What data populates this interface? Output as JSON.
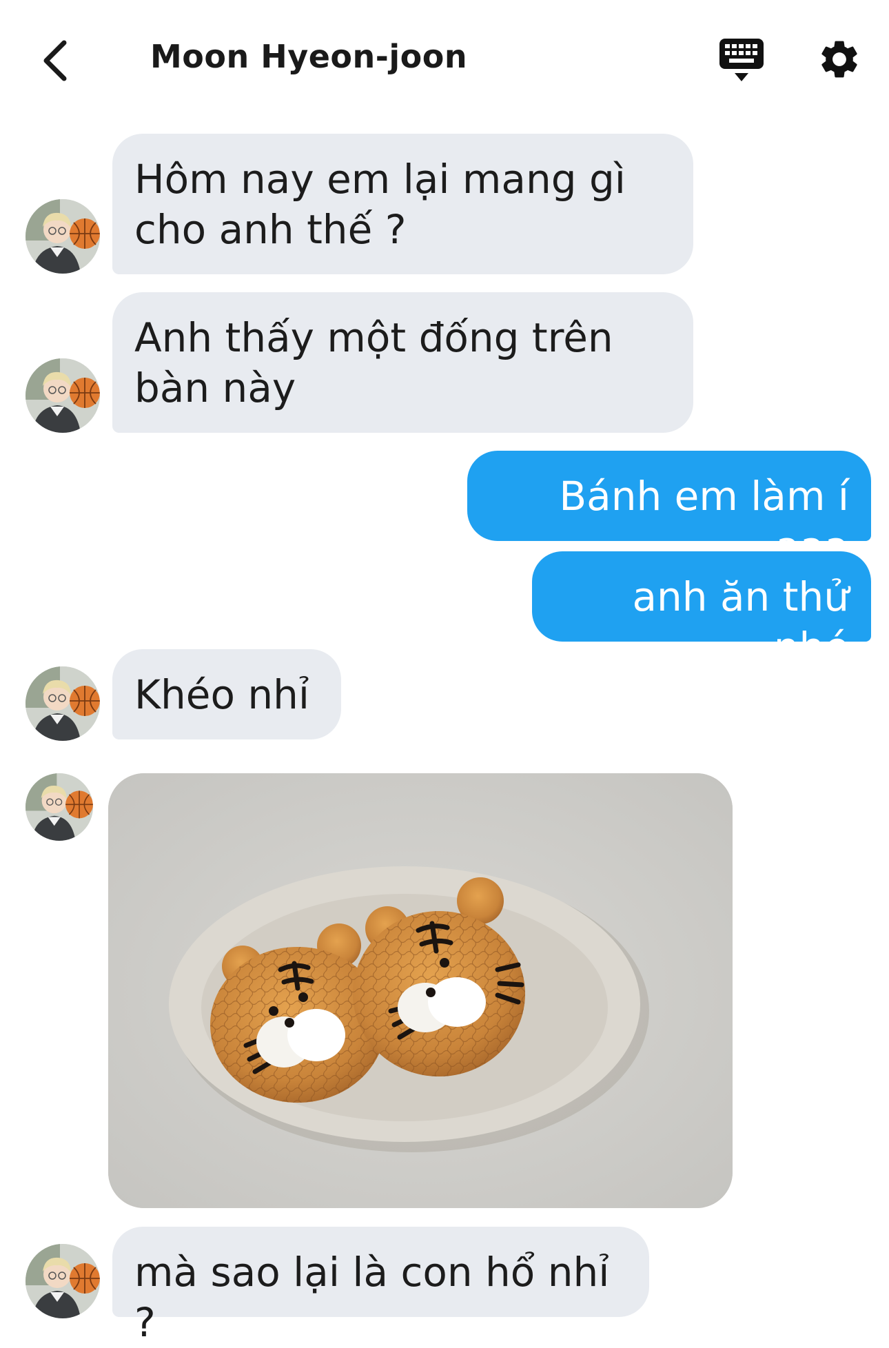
{
  "header": {
    "title": "Moon Hyeon-joon",
    "back_icon": "chevron-left-icon",
    "keyboard_icon": "keyboard-icon",
    "settings_icon": "gear-icon"
  },
  "messages": [
    {
      "direction": "incoming",
      "lines": [
        "Hôm nay em lại mang gì",
        "cho anh thế ?"
      ]
    },
    {
      "direction": "incoming",
      "lines": [
        "Anh thấy một đống trên",
        "bàn này"
      ]
    },
    {
      "direction": "outgoing",
      "text": "Bánh em làm í ạaa"
    },
    {
      "direction": "outgoing",
      "text": "anh ăn thử nhé"
    },
    {
      "direction": "incoming",
      "text": "Khéo nhỉ"
    },
    {
      "direction": "incoming",
      "type": "image",
      "image": "tiger-cream-puffs-photo"
    },
    {
      "direction": "incoming",
      "text": "mà sao lại là con hổ nhỉ ?"
    }
  ],
  "colors": {
    "incoming_bubble": "#e8ebf0",
    "outgoing_bubble": "#1fa1f1",
    "outgoing_text": "#ffffff",
    "incoming_text": "#1c1c1c"
  }
}
